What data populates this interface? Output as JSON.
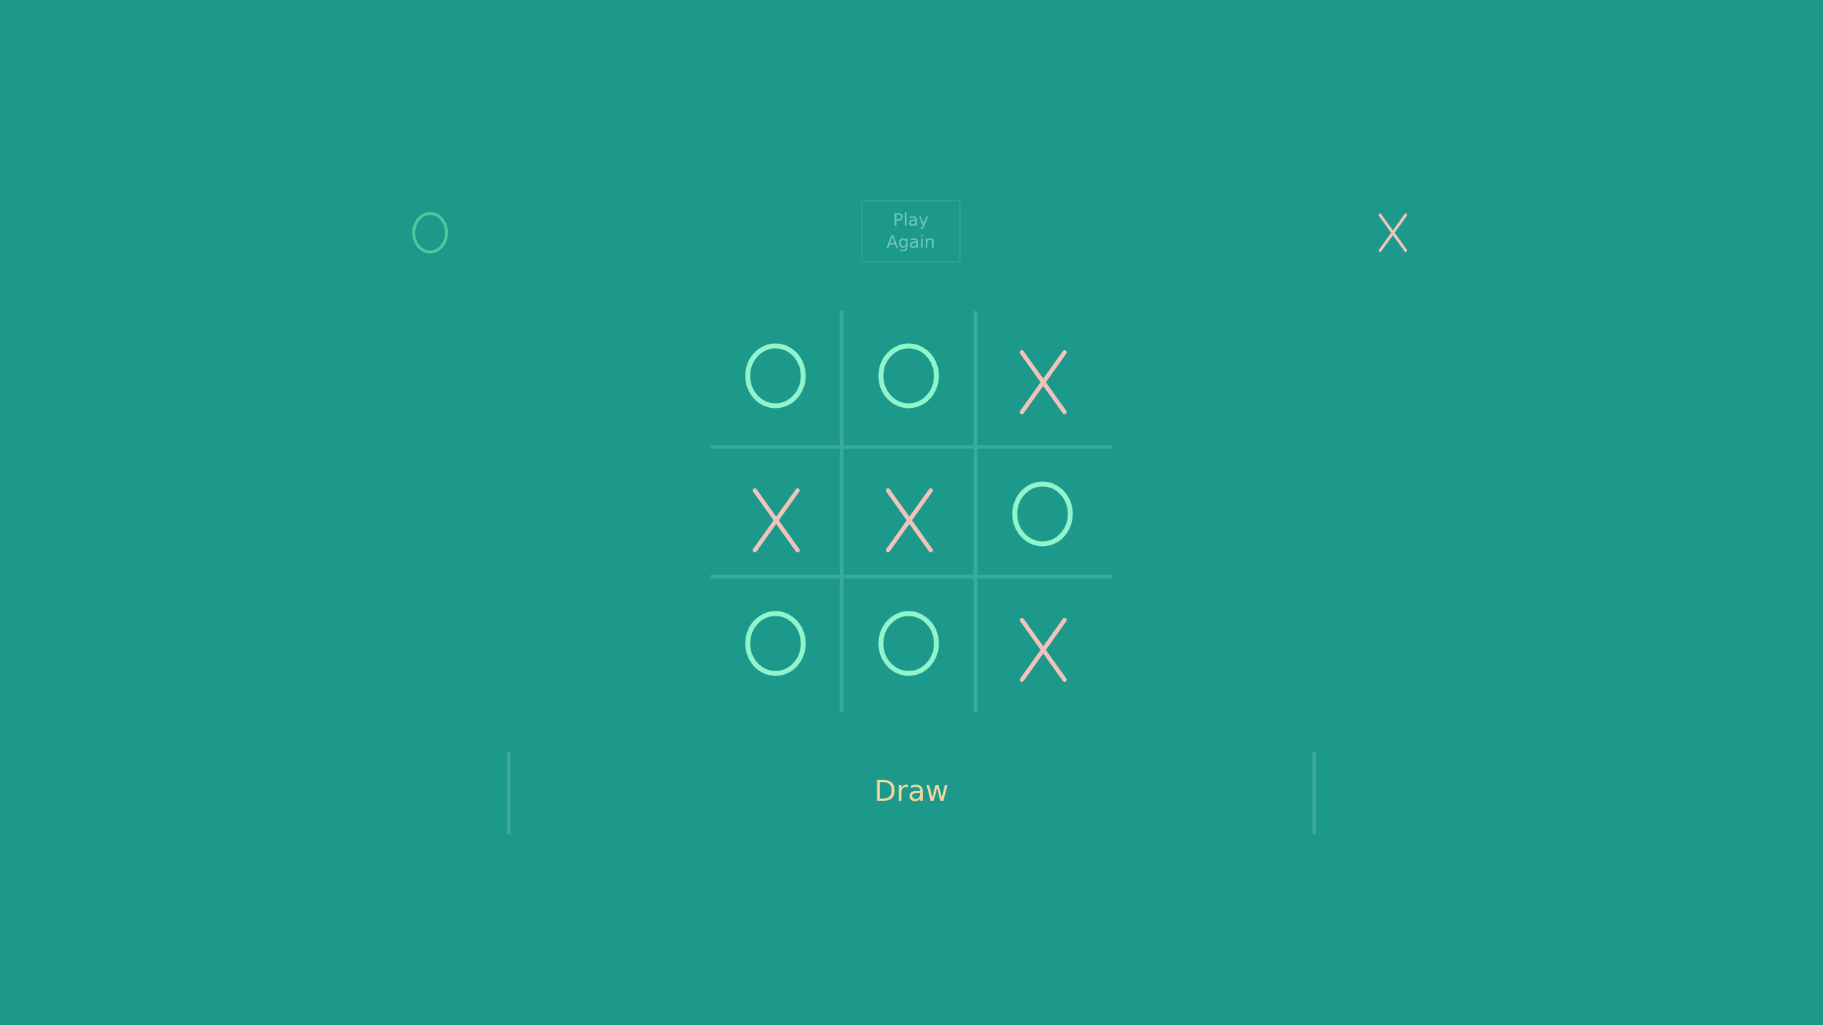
{
  "players": {
    "left": {
      "mark": "O",
      "color": "#4fc7a1"
    },
    "right": {
      "mark": "X",
      "color": "#f3c4bc"
    }
  },
  "play_again": {
    "label_line1": "Play",
    "label_line2": "Again"
  },
  "board": {
    "cells": [
      "O",
      "O",
      "X",
      "X",
      "X",
      "O",
      "O",
      "O",
      "X"
    ],
    "o_color": "#90f5cc",
    "x_color": "#f2c3bb",
    "grid_color": "#3aaa9d"
  },
  "status": {
    "text": "Draw",
    "color": "#f1d7a0"
  },
  "colors": {
    "background": "#1c998b"
  }
}
